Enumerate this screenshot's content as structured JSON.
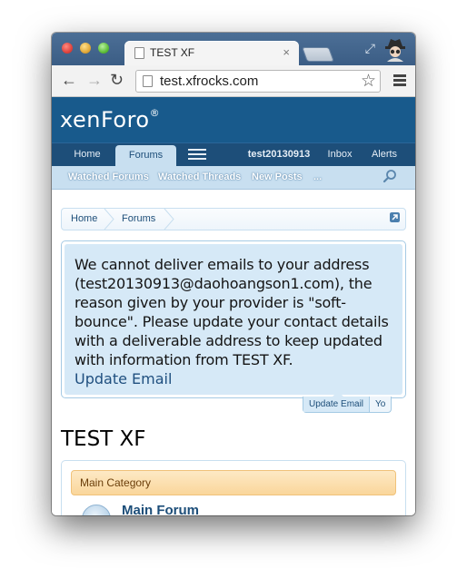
{
  "browser": {
    "tab_title": "TEST XF",
    "tab_close": "×",
    "url": "test.xfrocks.com",
    "star": "☆",
    "back": "←",
    "forward": "→",
    "reload": "↻",
    "fullscreen": "⤢"
  },
  "site": {
    "logo_text": "xenForo",
    "logo_mark": "®"
  },
  "nav": {
    "home": "Home",
    "forums": "Forums",
    "user": "test20130913",
    "inbox": "Inbox",
    "alerts": "Alerts"
  },
  "subnav": {
    "watched_forums": "Watched Forums",
    "watched_threads": "Watched Threads",
    "new_posts": "New Posts",
    "more": "..."
  },
  "breadcrumb": {
    "items": [
      "Home",
      "Forums"
    ]
  },
  "notice": {
    "message": "We cannot deliver emails to your address (test20130913@daohoangson1.com), the reason given by your provider is \"soft-bounce\". Please update your contact details with a deliverable address to keep updated with information from TEST XF.",
    "link": "Update Email",
    "tabs": [
      "Update Email",
      "Yo"
    ]
  },
  "main": {
    "title": "TEST XF",
    "category": "Main Category",
    "forum": "Main Forum"
  },
  "colors": {
    "header": "#185a8c",
    "navbar": "#1d4e79",
    "subnav": "#c8dff0",
    "notice_bg": "#d6e9f7",
    "category_bg": "#fad69b"
  }
}
